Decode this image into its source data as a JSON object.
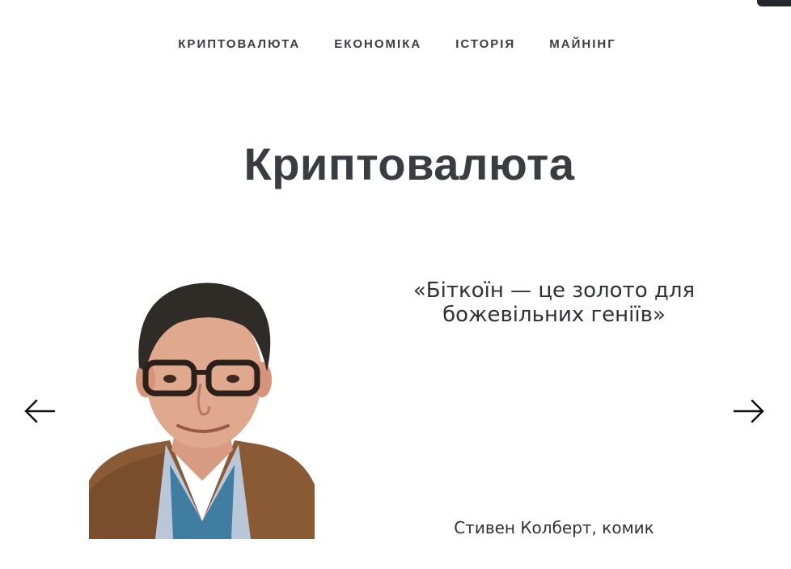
{
  "nav": {
    "items": [
      {
        "label": "КРИПТОВАЛЮТА"
      },
      {
        "label": "ЕКОНОМІКА"
      },
      {
        "label": "ІСТОРІЯ"
      },
      {
        "label": "МАЙНІНГ"
      }
    ]
  },
  "page": {
    "title": "Криптовалюта"
  },
  "carousel": {
    "quote": "«Біткоїн — це золото для божевільних геніїв»",
    "author": "Стивен Колберт, комик",
    "prev_icon": "arrow-left-icon",
    "next_icon": "arrow-right-icon"
  },
  "colors": {
    "text": "#3a3c42",
    "background": "#ffffff",
    "jacket": "#8a5a35",
    "hair": "#2f2b27"
  }
}
